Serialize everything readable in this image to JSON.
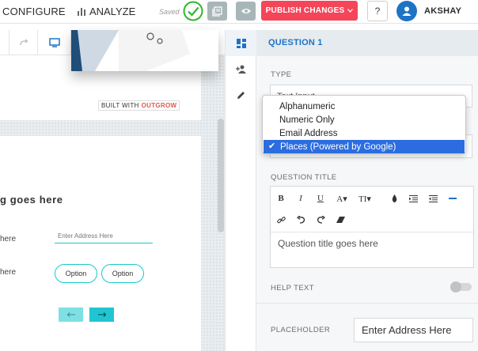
{
  "topbar": {
    "configure_label": "CONFIGURE",
    "analyze_label": "ANALYZE",
    "saved_label": "Saved",
    "publish_label": "PUBLISH CHANGES",
    "help_label": "?",
    "user_name": "AKSHAY",
    "colors": {
      "publish": "#f44559",
      "avatar": "#1d73c6",
      "saved_check": "#2fb82f"
    }
  },
  "canvas": {
    "built_with_label": "BUILT WITH",
    "brand_label": "OUTGROW",
    "question_heading": "g goes here",
    "question_label_1": "here",
    "question_label_2": "here",
    "address_placeholder": "Enter Address Here",
    "option_1": "Option",
    "option_2": "Option",
    "prev_icon": "arrow-left",
    "next_icon": "arrow-right",
    "accent": "#19c9c9"
  },
  "panel": {
    "title": "QUESTION 1",
    "type_label": "TYPE",
    "type_value": "Text Input",
    "type_options": [
      "Alphanumeric",
      "Numeric Only",
      "Email Address",
      "Places (Powered by Google)"
    ],
    "selected_option": "Places (Powered by Google)",
    "question_title_label": "QUESTION TITLE",
    "question_title_text": "Question title goes here",
    "help_text_label": "HELP TEXT",
    "help_text_enabled": false,
    "placeholder_label": "PLACEHOLDER",
    "placeholder_value": "Enter Address Here",
    "title_color": "#1d73c6"
  }
}
